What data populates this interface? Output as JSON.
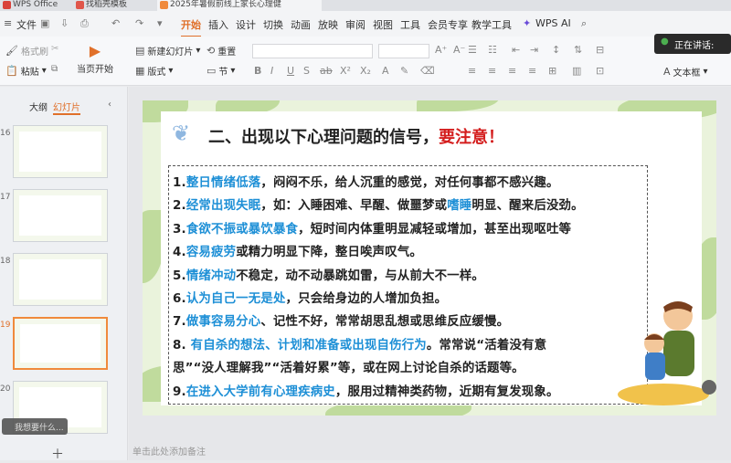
{
  "tabs": [
    {
      "label": "WPS Office",
      "color": "#d9423a"
    },
    {
      "label": "找稻壳模板",
      "color": "#e0564a"
    },
    {
      "label": "2025年暑假前线上家长心理健",
      "color": "#f08a3c"
    }
  ],
  "menu": [
    "文件",
    "开始",
    "插入",
    "设计",
    "切换",
    "动画",
    "放映",
    "审阅",
    "视图",
    "工具",
    "会员专享",
    "教学工具",
    "WPS AI"
  ],
  "toolbar": {
    "format_painter": "格式刷",
    "paste": "粘贴",
    "start_from_current": "当页开始",
    "new_slide": "新建幻灯片",
    "layout": "版式",
    "reset": "重置",
    "section": "节",
    "textbox": "文本框"
  },
  "speaking": "正在讲话:",
  "left_panel": {
    "outline_tab": "大纲",
    "slides_tab": "幻灯片",
    "slide_numbers": [
      "16",
      "17",
      "18",
      "19",
      "20"
    ]
  },
  "search_placeholder": "我想要什么...",
  "notes_placeholder": "单击此处添加备注",
  "slide": {
    "heading": "二、出现以下心理问题的信号，",
    "heading_warn": "要注意！",
    "items": [
      [
        {
          "t": "1.",
          "h": false
        },
        {
          "t": "整日情绪低落",
          "h": true
        },
        {
          "t": "，闷闷不乐，给人沉重的感觉，对任何事都不感兴趣。",
          "h": false
        }
      ],
      [
        {
          "t": "2.",
          "h": false
        },
        {
          "t": "经常出现失眠",
          "h": true
        },
        {
          "t": "，如：入睡困难、早醒、做噩梦或",
          "h": false
        },
        {
          "t": "嗜睡",
          "h": true
        },
        {
          "t": "明显、醒来后没劲。",
          "h": false
        }
      ],
      [
        {
          "t": "3.",
          "h": false
        },
        {
          "t": "食欲不振或暴饮暴食",
          "h": true
        },
        {
          "t": "，短时间内体重明显减轻或增加，甚至出现呕吐等",
          "h": false
        }
      ],
      [
        {
          "t": "4.",
          "h": false
        },
        {
          "t": "容易疲劳",
          "h": true
        },
        {
          "t": "或精力明显下降，整日唉声叹气。",
          "h": false
        }
      ],
      [
        {
          "t": "5.",
          "h": false
        },
        {
          "t": "情绪冲动",
          "h": true
        },
        {
          "t": "不稳定，动不动暴跳如雷，与从前大不一样。",
          "h": false
        }
      ],
      [
        {
          "t": "6.",
          "h": false
        },
        {
          "t": "认为自己一无是处",
          "h": true
        },
        {
          "t": "，只会给身边的人增加负担。",
          "h": false
        }
      ],
      [
        {
          "t": "7.",
          "h": false
        },
        {
          "t": "做事容易分心",
          "h": true
        },
        {
          "t": "、记性不好，常常胡思乱想或思维反应缓慢。",
          "h": false
        }
      ],
      [
        {
          "t": "8. ",
          "h": false
        },
        {
          "t": "有自杀的想法、计划和准备或出现自伤行为",
          "h": true
        },
        {
          "t": "。常常说“活着没有意",
          "h": false
        }
      ],
      [
        {
          "t": "思”“没人理解我”“活着好累”等，或在网上讨论自杀的话题等。",
          "h": false
        }
      ],
      [
        {
          "t": "9.",
          "h": false
        },
        {
          "t": "在进入大学前有心理疾病史",
          "h": true
        },
        {
          "t": "，服用过精神类药物，近期有复发现象。",
          "h": false
        }
      ]
    ]
  },
  "colors": {
    "highlight": "#1d8fd6",
    "warn": "#d41e1e",
    "accent": "#f08a3c"
  }
}
